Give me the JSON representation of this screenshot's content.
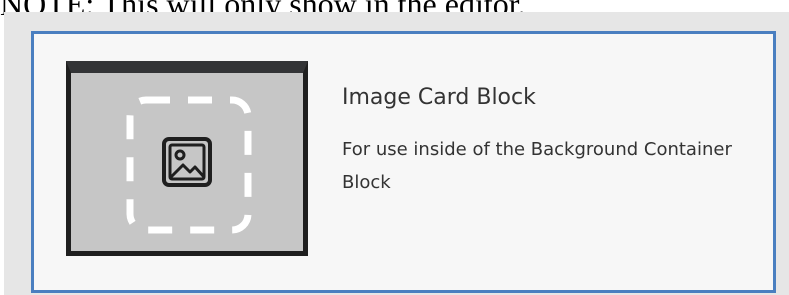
{
  "note_text": "NOTE:  This will only show in the editor.",
  "block": {
    "title": "Image Card Block",
    "description": "For use inside of the Background Container Block",
    "thumbnail_icon": "image-placeholder-icon"
  },
  "colors": {
    "card_border": "#4a7fc0",
    "card_background": "#f7f7f7",
    "thumbnail_fill": "#c6c6c6",
    "thumbnail_frame": "#1f1f1f"
  }
}
